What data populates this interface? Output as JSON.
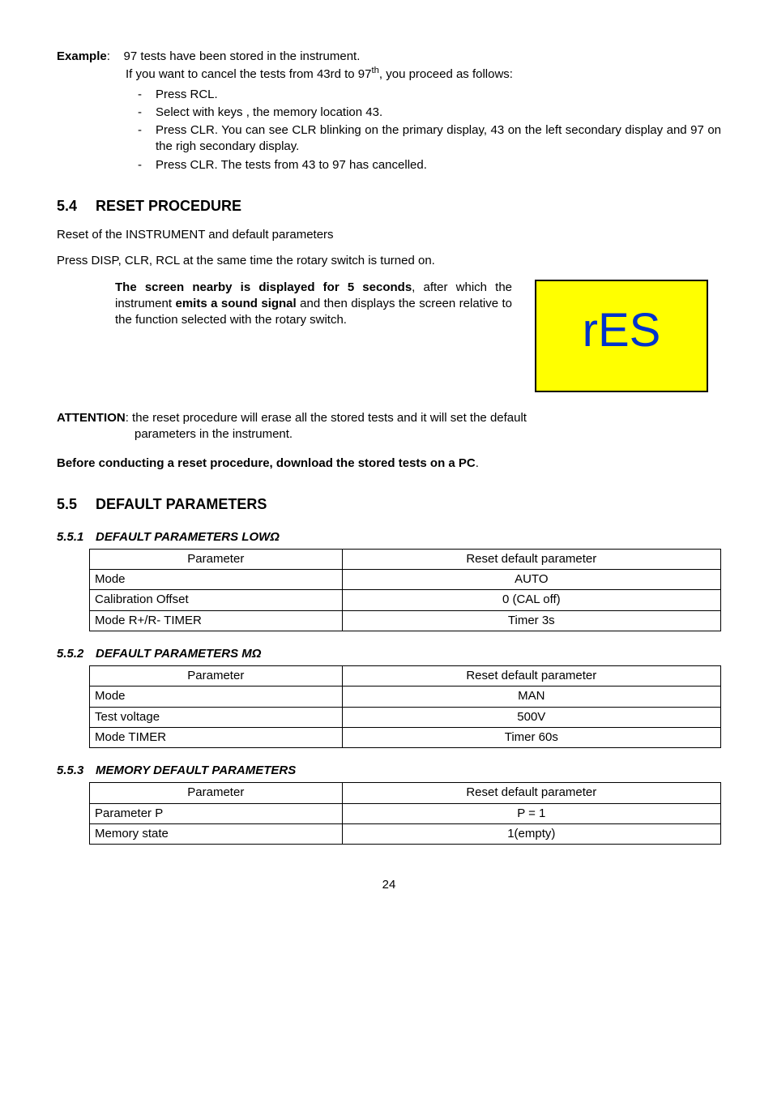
{
  "example": {
    "label": "Example",
    "intro_pre": "97 tests have been stored in the instrument.",
    "intro2_a": "If you want to cancel the tests from 43rd to 97",
    "intro2_sup": "th",
    "intro2_b": ", you proceed as follows:",
    "bullets": [
      "Press RCL.",
      "Select with keys   ,    the memory location 43.",
      "Press CLR. You can see CLR blinking on the primary display, 43 on the left secondary display and 97 on the righ secondary display.",
      "Press CLR. The tests from 43 to 97 has cancelled."
    ]
  },
  "reset": {
    "num": "5.4",
    "title": "RESET PROCEDURE",
    "p1": "Reset of the INSTRUMENT and default parameters",
    "p2": "Press DISP, CLR, RCL at the same time the rotary switch is turned on.",
    "box_a": "The screen nearby is displayed for 5 seconds",
    "box_b": ", after which the instrument ",
    "box_c": "emits a sound signal",
    "box_d": " and then displays the screen relative to the function selected with the rotary switch.",
    "res_text": "rES",
    "attn_label": "ATTENTION",
    "attn_body1": ": the reset procedure will erase all the stored tests and it will set the default",
    "attn_body2": "parameters in the instrument.",
    "before": "Before conducting a reset procedure, download the stored tests on a PC",
    "before_dot": "."
  },
  "default_params": {
    "num": "5.5",
    "title": "DEFAULT PARAMETERS",
    "s1": {
      "subnum": "5.5.1",
      "subtitle_a": "DEFAULT PARAMETERS LOW",
      "subtitle_b": "Ω",
      "h1": "Parameter",
      "h2": "Reset default parameter",
      "rows": [
        {
          "p": "Mode",
          "v": "AUTO"
        },
        {
          "p": "Calibration Offset",
          "v": "0 (CAL off)"
        },
        {
          "p": "Mode R+/R- TIMER",
          "v": "Timer 3s"
        }
      ]
    },
    "s2": {
      "subnum": "5.5.2",
      "subtitle_a": "DEFAULT PARAMETERS M",
      "subtitle_b": "Ω",
      "h1": "Parameter",
      "h2": "Reset default parameter",
      "rows": [
        {
          "p": "Mode",
          "v": "MAN"
        },
        {
          "p": "Test voltage",
          "v": "500V"
        },
        {
          "p": "Mode TIMER",
          "v": "Timer 60s"
        }
      ]
    },
    "s3": {
      "subnum": "5.5.3",
      "subtitle": "MEMORY DEFAULT PARAMETERS",
      "h1": "Parameter",
      "h2": "Reset default parameter",
      "rows": [
        {
          "p": "Parameter P",
          "v": "P = 1"
        },
        {
          "p": "Memory state",
          "v": "1(empty)"
        }
      ]
    }
  },
  "page_number": "24"
}
